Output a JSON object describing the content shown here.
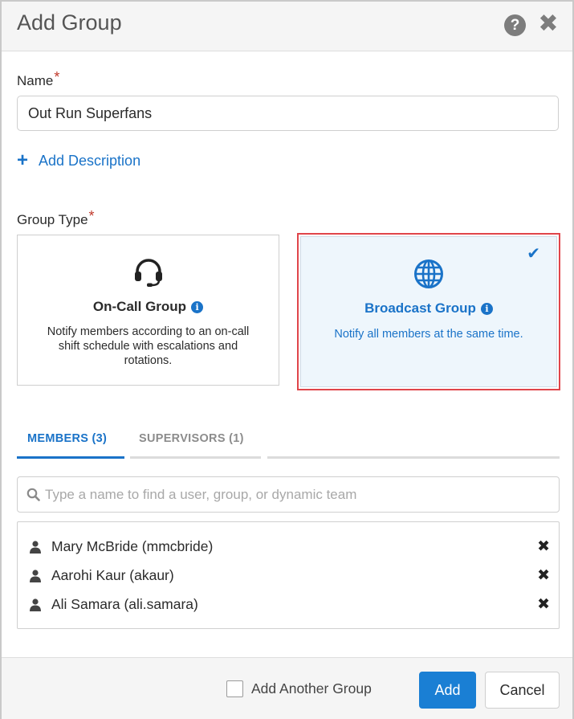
{
  "dialog": {
    "title": "Add Group",
    "help_icon": "question-circle-icon",
    "close_icon": "close-icon"
  },
  "name": {
    "label": "Name",
    "required_mark": "*",
    "value": "Out Run Superfans"
  },
  "add_description": {
    "icon": "plus-icon",
    "label": "Add Description"
  },
  "group_type": {
    "label": "Group Type",
    "required_mark": "*",
    "options": [
      {
        "icon": "headset-icon",
        "title": "On-Call Group",
        "description": "Notify members according to an on-call shift schedule with escalations and rotations.",
        "selected": false
      },
      {
        "icon": "globe-icon",
        "title": "Broadcast Group",
        "description": "Notify all members at the same time.",
        "selected": true
      }
    ]
  },
  "tabs": [
    {
      "label": "MEMBERS (3)",
      "active": true
    },
    {
      "label": "SUPERVISORS (1)",
      "active": false
    }
  ],
  "search": {
    "placeholder": "Type a name to find a user, group, or dynamic team",
    "value": ""
  },
  "members": [
    {
      "name": "Mary McBride (mmcbride)"
    },
    {
      "name": "Aarohi Kaur (akaur)"
    },
    {
      "name": "Ali Samara (ali.samara)"
    }
  ],
  "footer": {
    "add_another_label": "Add Another Group",
    "add_another_checked": false,
    "add_button": "Add",
    "cancel_button": "Cancel"
  },
  "colors": {
    "accent": "#1a73c8",
    "required": "#c0392b",
    "selection_outline": "#e0454a",
    "selected_card_bg": "#eef6fc"
  }
}
